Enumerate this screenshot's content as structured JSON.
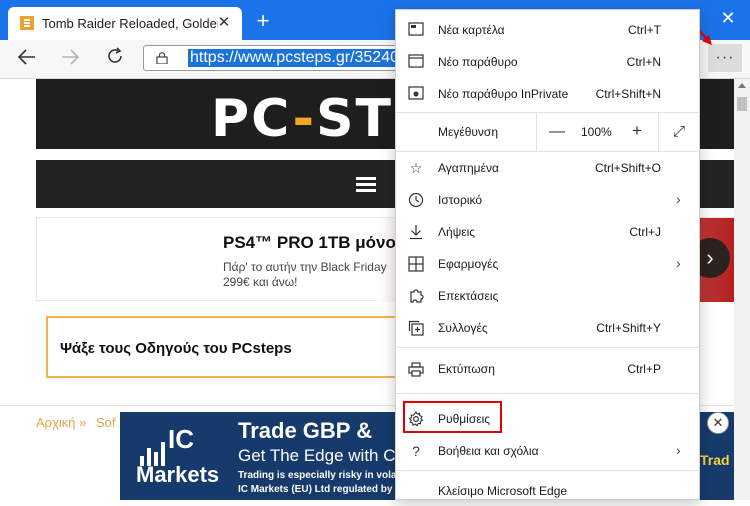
{
  "browser": {
    "tab_title": "Tomb Raider Reloaded, Golden J",
    "tab_close": "✕",
    "new_tab": "+",
    "window_close": "✕",
    "url": "https://www.pcsteps.gr/35240",
    "more_button": "···"
  },
  "page": {
    "logo_left": "PC",
    "logo_dash": "-",
    "logo_right": "ST",
    "promo_title": "PS4™ PRO 1TB μόνο",
    "promo_line1": "Πάρ' το αυτήν την Black Friday",
    "promo_line2": "299€ και άνω!",
    "promo_next": "›",
    "guides_text": "Ψάξε τους Οδηγούς του PCsteps",
    "breadcrumb_home": "Αρχική »",
    "breadcrumb_next": "Sof",
    "ad_logo_ic": "IC",
    "ad_logo_markets": "Markets",
    "ad_headline": "Trade GBP &",
    "ad_subline": "Get The Edge with C",
    "ad_fine1": "Trading is especially risky in volatil",
    "ad_fine2": "IC Markets (EU) Ltd regulated by C",
    "ad_side": "Trad",
    "ad_close": "✕"
  },
  "menu": {
    "new_tab": {
      "label": "Νέα καρτέλα",
      "shortcut": "Ctrl+T"
    },
    "new_window": {
      "label": "Νέο παράθυρο",
      "shortcut": "Ctrl+N"
    },
    "new_inprivate": {
      "label": "Νέο παράθυρο InPrivate",
      "shortcut": "Ctrl+Shift+N"
    },
    "zoom": {
      "label": "Μεγέθυνση",
      "minus": "—",
      "value": "100%",
      "plus": "+",
      "fullscreen": "⤢"
    },
    "favorites": {
      "label": "Αγαπημένα",
      "shortcut": "Ctrl+Shift+O"
    },
    "history": {
      "label": "Ιστορικό",
      "chevron": "›"
    },
    "downloads": {
      "label": "Λήψεις",
      "shortcut": "Ctrl+J"
    },
    "apps": {
      "label": "Εφαρμογές",
      "chevron": "›"
    },
    "extensions": {
      "label": "Επεκτάσεις"
    },
    "collections": {
      "label": "Συλλογές",
      "shortcut": "Ctrl+Shift+Y"
    },
    "print": {
      "label": "Εκτύπωση",
      "shortcut": "Ctrl+P"
    },
    "settings": {
      "label": "Ρυθμίσεις"
    },
    "help": {
      "label": "Βοήθεια και σχόλια",
      "chevron": "›"
    },
    "close_edge": {
      "label": "Κλείσιμο Microsoft Edge"
    }
  },
  "colors": {
    "titlebar": "#1a73e8",
    "highlight_box": "#e10000",
    "annotation_arrow": "#e10000",
    "logo_accent": "#f5a623"
  }
}
